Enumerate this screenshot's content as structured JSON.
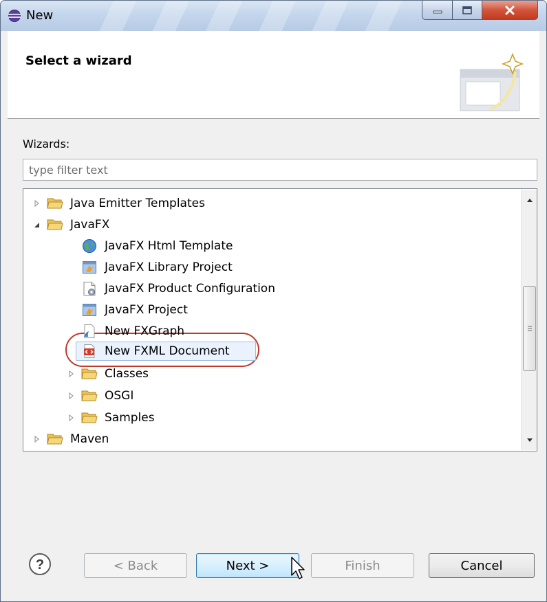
{
  "window": {
    "title": "New",
    "controls": [
      "minimize",
      "maximize",
      "close"
    ]
  },
  "header": {
    "title": "Select a wizard",
    "graphic_icon": "wizard-banner-icon"
  },
  "filter": {
    "label": "Wizards:",
    "placeholder": "type filter text",
    "value": ""
  },
  "tree": {
    "items": [
      {
        "label": "Java Emitter Templates",
        "level": 0,
        "type": "folder",
        "expanded": false
      },
      {
        "label": "JavaFX",
        "level": 0,
        "type": "folder",
        "expanded": true
      },
      {
        "label": "JavaFX Html Template",
        "level": 1,
        "type": "globe"
      },
      {
        "label": "JavaFX Library Project",
        "level": 1,
        "type": "project"
      },
      {
        "label": "JavaFX Product Configuration",
        "level": 1,
        "type": "config"
      },
      {
        "label": "JavaFX Project",
        "level": 1,
        "type": "project"
      },
      {
        "label": "New FXGraph",
        "level": 1,
        "type": "fxgraph"
      },
      {
        "label": "New FXML Document",
        "level": 1,
        "type": "fxml",
        "selected": true
      },
      {
        "label": "Classes",
        "level": 1,
        "type": "folder",
        "expanded": false
      },
      {
        "label": "OSGI",
        "level": 1,
        "type": "folder",
        "expanded": false
      },
      {
        "label": "Samples",
        "level": 1,
        "type": "folder",
        "expanded": false
      },
      {
        "label": "Maven",
        "level": 0,
        "type": "folder",
        "expanded": false
      }
    ]
  },
  "buttons": {
    "help": "?",
    "back": "< Back",
    "next": "Next >",
    "finish": "Finish",
    "cancel": "Cancel"
  },
  "colors": {
    "highlight_oval": "#c0392b",
    "next_border": "#3c7fb1",
    "folder": "#e8c15a"
  }
}
